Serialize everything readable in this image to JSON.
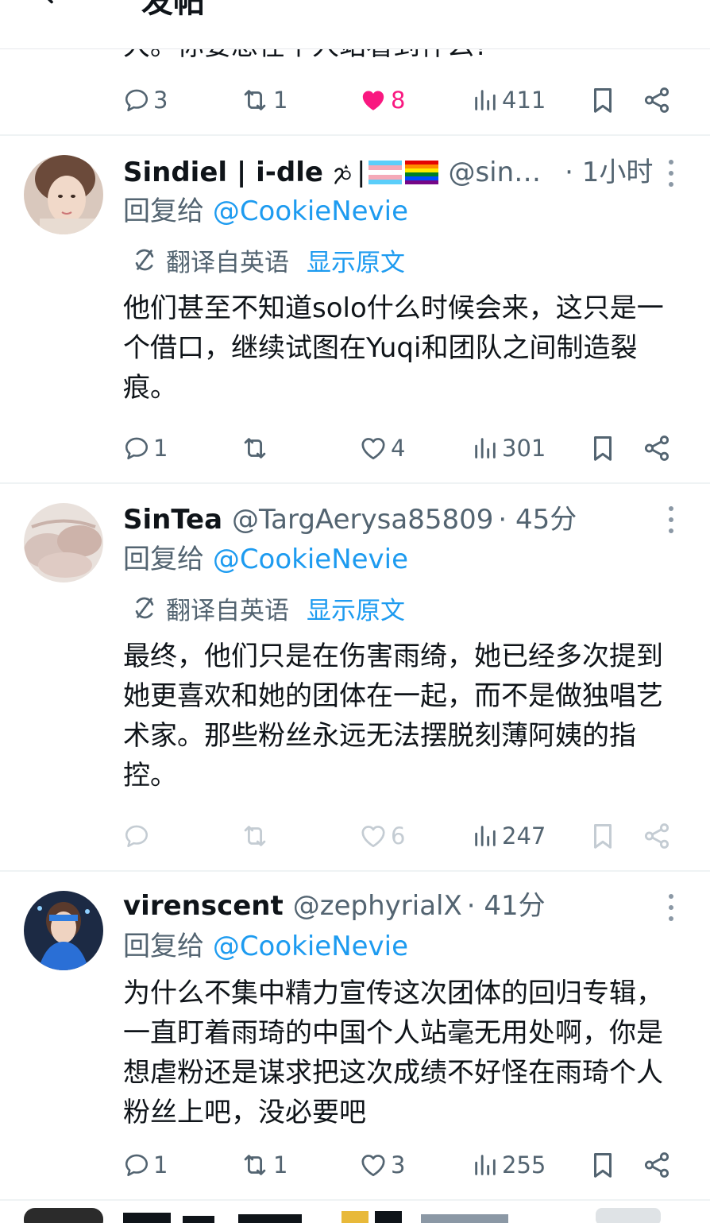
{
  "header": {
    "title": "发帖"
  },
  "cut_text": "大。你要想在个人站看到什么?",
  "colors": {
    "accent": "#1d9bf0",
    "like": "#f91880",
    "secondary": "#536471"
  },
  "tweets": [
    {
      "actions": {
        "replies": "3",
        "retweets": "1",
        "likes": "8",
        "views": "411",
        "liked": true
      }
    },
    {
      "name": "Sindiel | i-dle",
      "handle": "@sin…",
      "time": "· 1小时",
      "reply_prefix": "回复给",
      "reply_to": "@CookieNevie",
      "translate_label": "翻译自英语",
      "translate_show": "显示原文",
      "text": "他们甚至不知道solo什么时候会来，这只是一个借口，继续试图在Yuqi和团队之间制造裂痕。",
      "actions": {
        "replies": "1",
        "retweets": "",
        "likes": "4",
        "views": "301"
      }
    },
    {
      "name": "SinTea",
      "handle": "@TargAerysa85809",
      "time": "· 45分",
      "reply_prefix": "回复给",
      "reply_to": "@CookieNevie",
      "translate_label": "翻译自英语",
      "translate_show": "显示原文",
      "text": "最终，他们只是在伤害雨绮，她已经多次提到她更喜欢和她的团体在一起，而不是做独唱艺术家。那些粉丝永远无法摆脱刻薄阿姨的指控。",
      "actions": {
        "replies": "",
        "retweets": "",
        "likes": "6",
        "views": "247"
      }
    },
    {
      "name": "virenscent",
      "handle": "@zephyrialX",
      "time": "· 41分",
      "reply_prefix": "回复给",
      "reply_to": "@CookieNevie",
      "text": "为什么不集中精力宣传这次团体的回归专辑，一直盯着雨琦的中国个人站毫无用处啊，你是想虐粉还是谋求把这次成绩不好怪在雨琦个人粉丝上吧，没必要吧",
      "actions": {
        "replies": "1",
        "retweets": "1",
        "likes": "3",
        "views": "255"
      }
    }
  ]
}
